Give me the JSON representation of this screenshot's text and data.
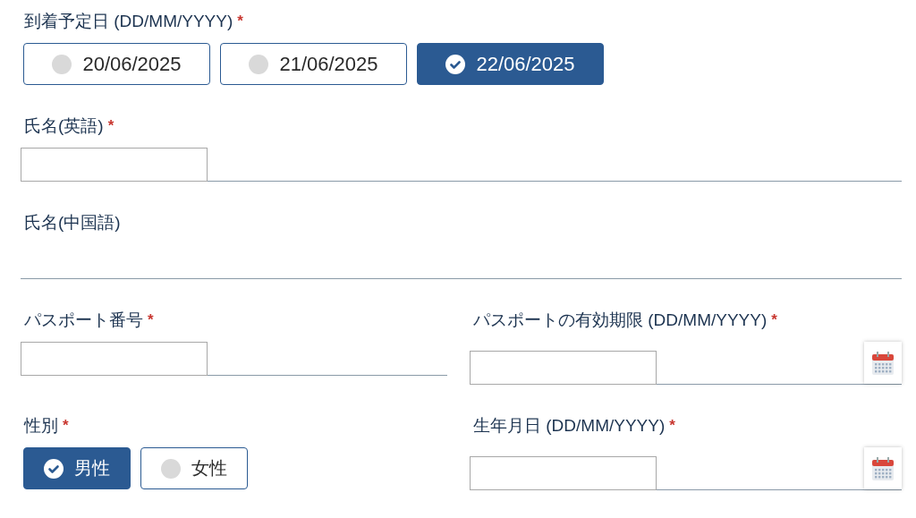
{
  "rows": [
    [
      {
        "kind": "choice",
        "label": "到着予定日 (DD/MM/YYYY)",
        "required_mark": "*",
        "options": [
          {
            "label": "20/06/2025",
            "selected": false
          },
          {
            "label": "21/06/2025",
            "selected": false
          },
          {
            "label": "22/06/2025",
            "selected": true
          }
        ]
      }
    ],
    [
      {
        "kind": "text",
        "label": "氏名(英語)",
        "required_mark": "*"
      }
    ],
    [
      {
        "kind": "underline",
        "label": "氏名(中国語)"
      }
    ],
    [
      {
        "kind": "text",
        "label": "パスポート番号",
        "required_mark": "*"
      },
      {
        "kind": "date",
        "label": "パスポートの有効期限 (DD/MM/YYYY)",
        "required_mark": "*"
      }
    ],
    [
      {
        "kind": "choice",
        "label": "性別",
        "required_mark": "*",
        "options": [
          {
            "label": "男性",
            "selected": true
          },
          {
            "label": "女性",
            "selected": false
          }
        ]
      },
      {
        "kind": "date",
        "label": "生年月日 (DD/MM/YYYY)",
        "required_mark": "*"
      }
    ]
  ]
}
